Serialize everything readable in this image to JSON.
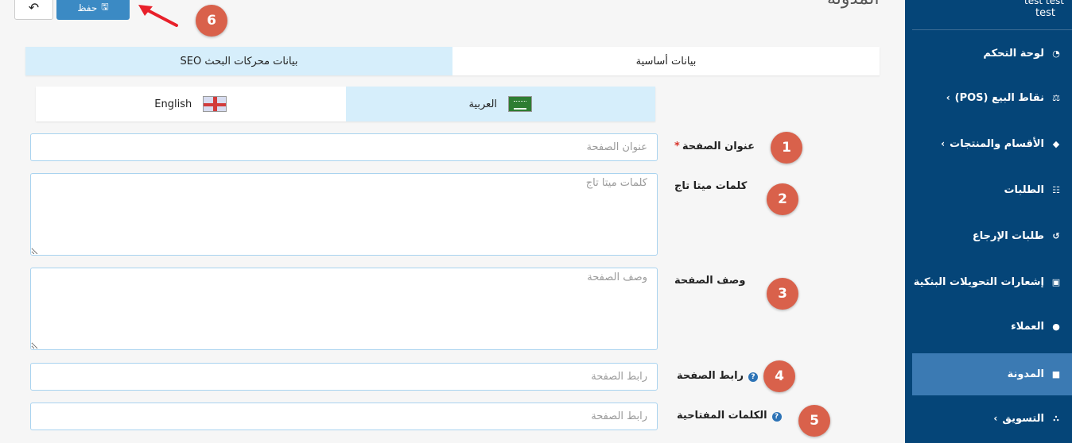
{
  "header": {
    "page_title": "المدونة",
    "save_label": "حفظ"
  },
  "user": {
    "name": "test test",
    "role": "test"
  },
  "sidebar": {
    "items": [
      {
        "label": "لوحة التحكم",
        "icon": "dashboard-icon",
        "has_submenu": false
      },
      {
        "label": "نقاط البيع (POS)",
        "icon": "balance-scale-icon",
        "has_submenu": true
      },
      {
        "label": "الأقسام والمنتجات",
        "icon": "tag-icon",
        "has_submenu": true
      },
      {
        "label": "الطلبات",
        "icon": "cart-icon",
        "has_submenu": false
      },
      {
        "label": "طلبات الإرجاع",
        "icon": "undo-icon",
        "has_submenu": false
      },
      {
        "label": "إشعارات التحويلات البنكية",
        "icon": "money-icon",
        "has_submenu": false
      },
      {
        "label": "العملاء",
        "icon": "user-icon",
        "has_submenu": false
      },
      {
        "label": "المدونة",
        "icon": "book-icon",
        "has_submenu": false,
        "active": true
      },
      {
        "label": "التسويق",
        "icon": "share-icon",
        "has_submenu": true
      }
    ]
  },
  "tabs": [
    {
      "label": "بيانات أساسية",
      "active": false
    },
    {
      "label": "بيانات محركات البحث SEO",
      "active": true
    }
  ],
  "languages": [
    {
      "label": "العربية",
      "flag": "saudi-flag-icon",
      "active": true
    },
    {
      "label": "English",
      "flag": "uk-flag-icon",
      "active": false
    }
  ],
  "form": {
    "page_title": {
      "label": "عنوان الصفحة",
      "required": "*",
      "placeholder": "عنوان الصفحة",
      "value": ""
    },
    "meta_keywords": {
      "label": "كلمات ميتا تاج",
      "placeholder": "كلمات ميتا تاج",
      "value": ""
    },
    "page_description": {
      "label": "وصف الصفحة",
      "placeholder": "وصف الصفحة",
      "value": ""
    },
    "page_link": {
      "label": "رابط الصفحة",
      "placeholder": "رابط الصفحة",
      "value": ""
    },
    "keywords": {
      "label": "الكلمات المفتاحية",
      "placeholder": "رابط الصفحة",
      "value": ""
    }
  },
  "callouts": [
    "1",
    "2",
    "3",
    "4",
    "5",
    "6"
  ],
  "colors": {
    "sidebar_bg": "#054578",
    "sidebar_active": "#3b7ab3",
    "save_button": "#3b8ac4",
    "callout": "#d9614b",
    "active_tab": "#d6eefb",
    "arrow": "#e8202a"
  }
}
